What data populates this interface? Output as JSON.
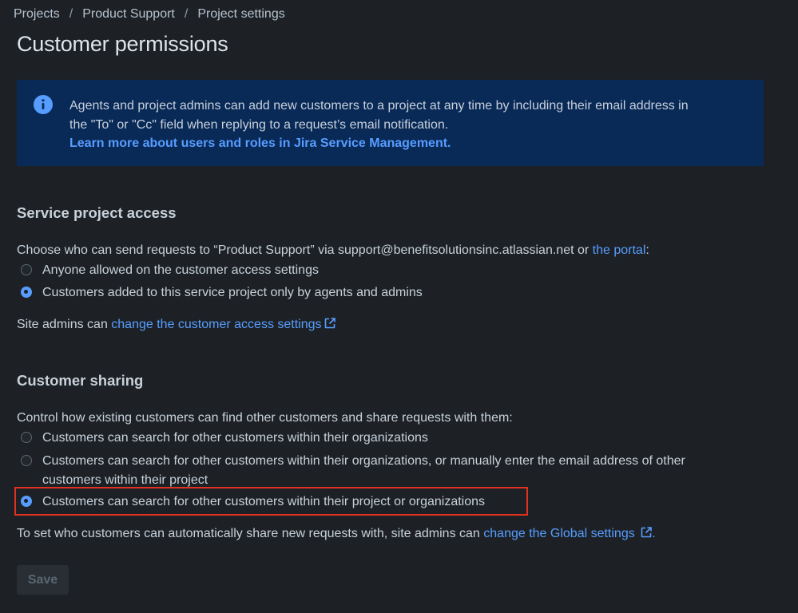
{
  "breadcrumb": {
    "items": [
      "Projects",
      "Product Support",
      "Project settings"
    ],
    "separator": "/"
  },
  "page": {
    "title": "Customer permissions"
  },
  "info_banner": {
    "line1": "Agents and project admins can add new customers to a project at any time by including their email address in",
    "line2": "the \"To\" or \"Cc\" field when replying to a request’s email notification.",
    "link": "Learn more about users and roles in Jira Service Management."
  },
  "service_access": {
    "heading": "Service project access",
    "intro": "Choose who can send requests to “Product Support” via support@benefitsolutionsinc.atlassian.net or ",
    "intro_link": "the portal",
    "intro_suffix": ":",
    "options": [
      {
        "label": "Anyone allowed on the customer access settings",
        "selected": false
      },
      {
        "label": "Customers added to this service project only by agents and admins",
        "selected": true
      }
    ],
    "site_admin_prefix": "Site admins can ",
    "site_admin_link": "change the customer access settings"
  },
  "customer_sharing": {
    "heading": "Customer sharing",
    "intro": "Control how existing customers can find other customers and share requests with them:",
    "options": [
      {
        "label": "Customers can search for other customers within their organizations",
        "selected": false
      },
      {
        "label_line1": "Customers can search for other customers within their organizations, or manually enter the email address of other",
        "label_line2": "customers within their project",
        "selected": false
      },
      {
        "label": "Customers can search for other customers within their project or organizations",
        "selected": true
      }
    ],
    "global_prefix": "To set who customers can automatically share new requests with, site admins can ",
    "global_link": "change the Global settings",
    "global_suffix": "."
  },
  "save_label": "Save",
  "colors": {
    "background": "#1d2125",
    "banner": "#092957",
    "link": "#579dff",
    "highlight": "#e0321f"
  }
}
